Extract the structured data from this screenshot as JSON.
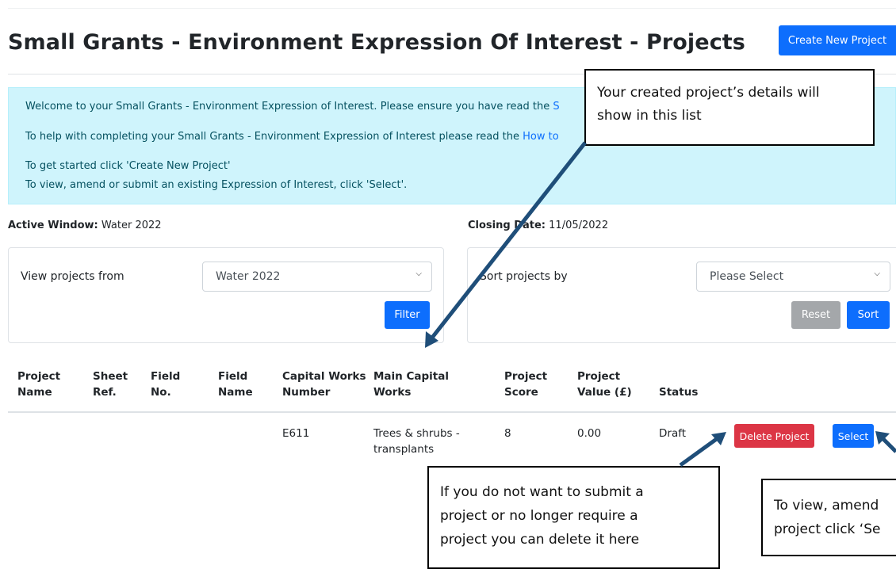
{
  "header": {
    "title": "Small Grants - Environment Expression Of Interest - Projects",
    "create_button": "Create New Project"
  },
  "alert": {
    "line1_text": "Welcome to your Small Grants - Environment Expression of Interest. Please ensure you have read the ",
    "line1_link": "S",
    "line2_text": "To help with completing your Small Grants - Environment Expression of Interest please read the ",
    "line2_link": "How to",
    "line3": "To get started click 'Create New Project'",
    "line4": "To view, amend or submit an existing Expression of Interest, click 'Select'."
  },
  "info": {
    "active_window_label": "Active Window:",
    "active_window_value": "Water 2022",
    "closing_date_label": "Closing Date:",
    "closing_date_value": "11/05/2022"
  },
  "filter_panel": {
    "label": "View projects from",
    "selected": "Water 2022",
    "filter_button": "Filter"
  },
  "sort_panel": {
    "label": "Sort projects by",
    "selected": "Please Select",
    "reset_button": "Reset",
    "sort_button": "Sort"
  },
  "table": {
    "headers": [
      [
        "Project",
        "Name"
      ],
      [
        "Sheet",
        "Ref."
      ],
      [
        "Field",
        "No."
      ],
      [
        "Field",
        "Name"
      ],
      [
        "Capital Works",
        "Number"
      ],
      [
        "Main Capital",
        "Works"
      ],
      [
        "Project",
        "Score"
      ],
      [
        "Project",
        "Value (£)"
      ],
      [
        "",
        "Status"
      ]
    ],
    "rows": [
      {
        "project_name": "",
        "sheet_ref": "",
        "field_no": "",
        "field_name": "",
        "capital_works_number": "E611",
        "main_capital_works_line1": "Trees & shrubs -",
        "main_capital_works_line2": "transplants",
        "project_score": "8",
        "project_value": "0.00",
        "status": "Draft",
        "delete_button": "Delete Project",
        "select_button": "Select"
      }
    ]
  },
  "callouts": {
    "top": [
      "Your created project’s details will",
      "show in this list"
    ],
    "delete": [
      "If you do not want to submit a",
      "project or no longer require a",
      "project you can delete it here"
    ],
    "select": [
      "To view, amend",
      "project click ‘Se"
    ]
  },
  "colors": {
    "primary": "#0d6efd",
    "danger": "#dc3545",
    "secondary": "#a4a7aa",
    "alert_bg": "#cff4fc",
    "alert_text": "#055160",
    "arrow": "#1f4e79"
  }
}
